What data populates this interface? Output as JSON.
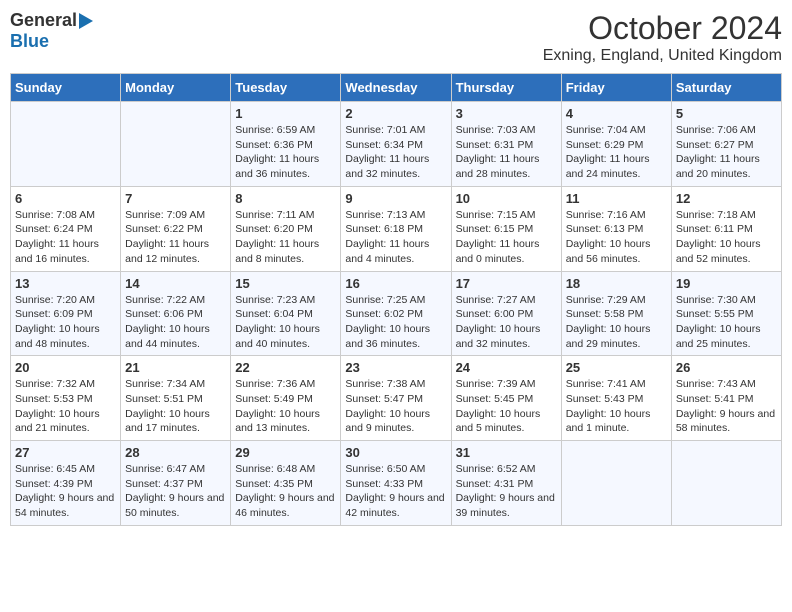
{
  "header": {
    "logo_general": "General",
    "logo_blue": "Blue",
    "month_title": "October 2024",
    "location": "Exning, England, United Kingdom"
  },
  "days_of_week": [
    "Sunday",
    "Monday",
    "Tuesday",
    "Wednesday",
    "Thursday",
    "Friday",
    "Saturday"
  ],
  "weeks": [
    [
      {
        "day": "",
        "info": ""
      },
      {
        "day": "",
        "info": ""
      },
      {
        "day": "1",
        "info": "Sunrise: 6:59 AM\nSunset: 6:36 PM\nDaylight: 11 hours and 36 minutes."
      },
      {
        "day": "2",
        "info": "Sunrise: 7:01 AM\nSunset: 6:34 PM\nDaylight: 11 hours and 32 minutes."
      },
      {
        "day": "3",
        "info": "Sunrise: 7:03 AM\nSunset: 6:31 PM\nDaylight: 11 hours and 28 minutes."
      },
      {
        "day": "4",
        "info": "Sunrise: 7:04 AM\nSunset: 6:29 PM\nDaylight: 11 hours and 24 minutes."
      },
      {
        "day": "5",
        "info": "Sunrise: 7:06 AM\nSunset: 6:27 PM\nDaylight: 11 hours and 20 minutes."
      }
    ],
    [
      {
        "day": "6",
        "info": "Sunrise: 7:08 AM\nSunset: 6:24 PM\nDaylight: 11 hours and 16 minutes."
      },
      {
        "day": "7",
        "info": "Sunrise: 7:09 AM\nSunset: 6:22 PM\nDaylight: 11 hours and 12 minutes."
      },
      {
        "day": "8",
        "info": "Sunrise: 7:11 AM\nSunset: 6:20 PM\nDaylight: 11 hours and 8 minutes."
      },
      {
        "day": "9",
        "info": "Sunrise: 7:13 AM\nSunset: 6:18 PM\nDaylight: 11 hours and 4 minutes."
      },
      {
        "day": "10",
        "info": "Sunrise: 7:15 AM\nSunset: 6:15 PM\nDaylight: 11 hours and 0 minutes."
      },
      {
        "day": "11",
        "info": "Sunrise: 7:16 AM\nSunset: 6:13 PM\nDaylight: 10 hours and 56 minutes."
      },
      {
        "day": "12",
        "info": "Sunrise: 7:18 AM\nSunset: 6:11 PM\nDaylight: 10 hours and 52 minutes."
      }
    ],
    [
      {
        "day": "13",
        "info": "Sunrise: 7:20 AM\nSunset: 6:09 PM\nDaylight: 10 hours and 48 minutes."
      },
      {
        "day": "14",
        "info": "Sunrise: 7:22 AM\nSunset: 6:06 PM\nDaylight: 10 hours and 44 minutes."
      },
      {
        "day": "15",
        "info": "Sunrise: 7:23 AM\nSunset: 6:04 PM\nDaylight: 10 hours and 40 minutes."
      },
      {
        "day": "16",
        "info": "Sunrise: 7:25 AM\nSunset: 6:02 PM\nDaylight: 10 hours and 36 minutes."
      },
      {
        "day": "17",
        "info": "Sunrise: 7:27 AM\nSunset: 6:00 PM\nDaylight: 10 hours and 32 minutes."
      },
      {
        "day": "18",
        "info": "Sunrise: 7:29 AM\nSunset: 5:58 PM\nDaylight: 10 hours and 29 minutes."
      },
      {
        "day": "19",
        "info": "Sunrise: 7:30 AM\nSunset: 5:55 PM\nDaylight: 10 hours and 25 minutes."
      }
    ],
    [
      {
        "day": "20",
        "info": "Sunrise: 7:32 AM\nSunset: 5:53 PM\nDaylight: 10 hours and 21 minutes."
      },
      {
        "day": "21",
        "info": "Sunrise: 7:34 AM\nSunset: 5:51 PM\nDaylight: 10 hours and 17 minutes."
      },
      {
        "day": "22",
        "info": "Sunrise: 7:36 AM\nSunset: 5:49 PM\nDaylight: 10 hours and 13 minutes."
      },
      {
        "day": "23",
        "info": "Sunrise: 7:38 AM\nSunset: 5:47 PM\nDaylight: 10 hours and 9 minutes."
      },
      {
        "day": "24",
        "info": "Sunrise: 7:39 AM\nSunset: 5:45 PM\nDaylight: 10 hours and 5 minutes."
      },
      {
        "day": "25",
        "info": "Sunrise: 7:41 AM\nSunset: 5:43 PM\nDaylight: 10 hours and 1 minute."
      },
      {
        "day": "26",
        "info": "Sunrise: 7:43 AM\nSunset: 5:41 PM\nDaylight: 9 hours and 58 minutes."
      }
    ],
    [
      {
        "day": "27",
        "info": "Sunrise: 6:45 AM\nSunset: 4:39 PM\nDaylight: 9 hours and 54 minutes."
      },
      {
        "day": "28",
        "info": "Sunrise: 6:47 AM\nSunset: 4:37 PM\nDaylight: 9 hours and 50 minutes."
      },
      {
        "day": "29",
        "info": "Sunrise: 6:48 AM\nSunset: 4:35 PM\nDaylight: 9 hours and 46 minutes."
      },
      {
        "day": "30",
        "info": "Sunrise: 6:50 AM\nSunset: 4:33 PM\nDaylight: 9 hours and 42 minutes."
      },
      {
        "day": "31",
        "info": "Sunrise: 6:52 AM\nSunset: 4:31 PM\nDaylight: 9 hours and 39 minutes."
      },
      {
        "day": "",
        "info": ""
      },
      {
        "day": "",
        "info": ""
      }
    ]
  ]
}
